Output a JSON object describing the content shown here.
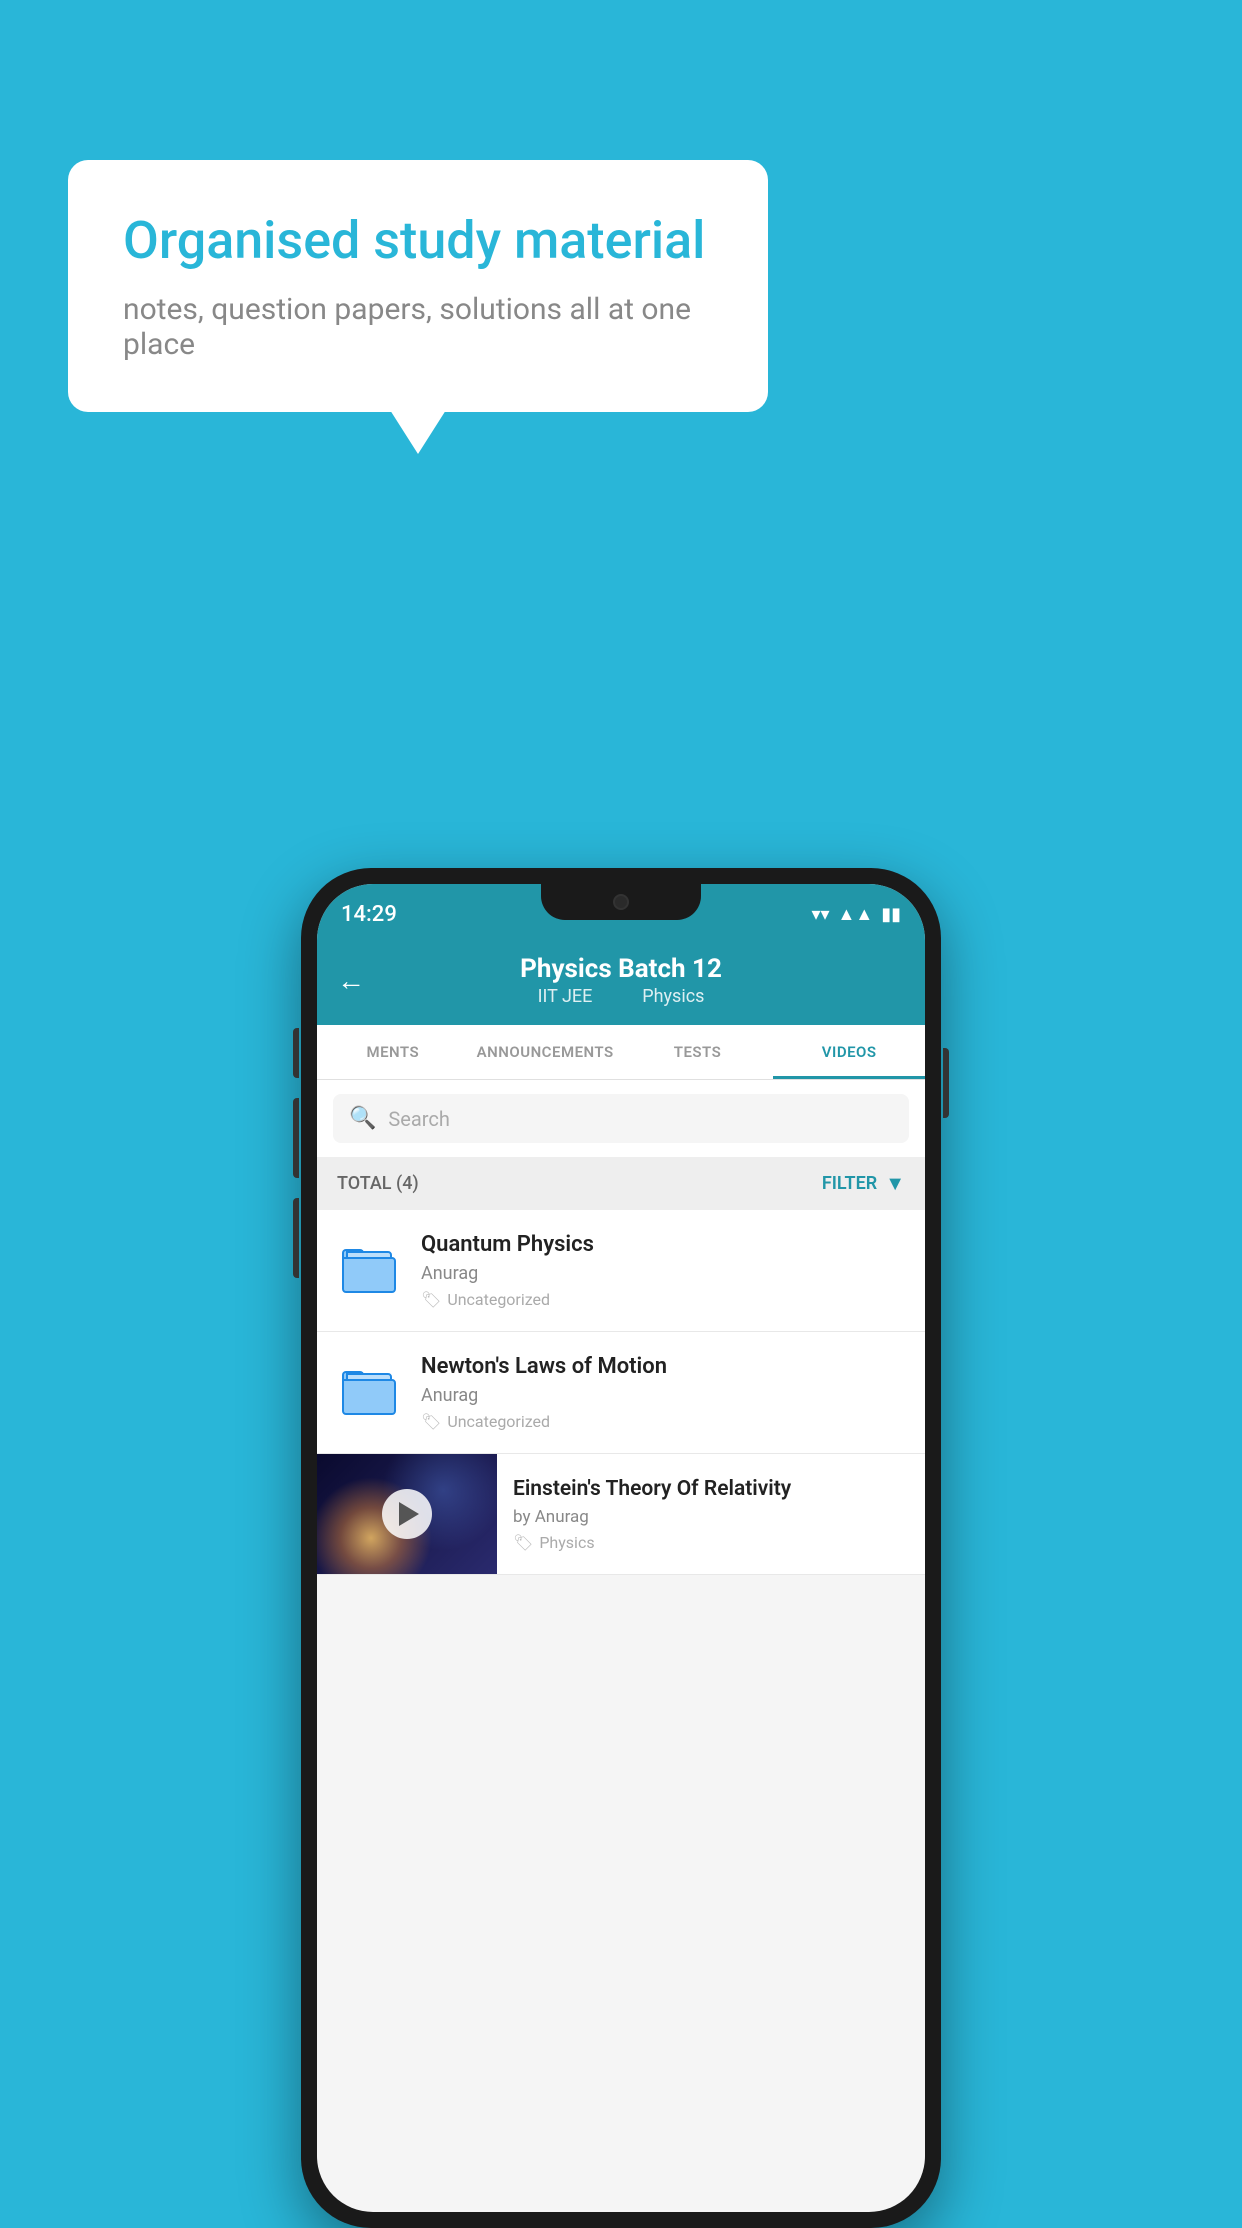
{
  "background_color": "#29B6D8",
  "speech_bubble": {
    "title": "Organised study material",
    "subtitle": "notes, question papers, solutions all at one place"
  },
  "status_bar": {
    "time": "14:29",
    "wifi": "▼",
    "signal": "▲",
    "battery": "▮"
  },
  "header": {
    "back_label": "←",
    "title": "Physics Batch 12",
    "subtitle_part1": "IIT JEE",
    "subtitle_part2": "Physics"
  },
  "tabs": [
    {
      "label": "MENTS",
      "active": false
    },
    {
      "label": "ANNOUNCEMENTS",
      "active": false
    },
    {
      "label": "TESTS",
      "active": false
    },
    {
      "label": "VIDEOS",
      "active": true
    }
  ],
  "search": {
    "placeholder": "Search"
  },
  "filter_bar": {
    "total_label": "TOTAL (4)",
    "filter_label": "FILTER"
  },
  "list_items": [
    {
      "id": "item1",
      "title": "Quantum Physics",
      "author": "Anurag",
      "tag": "Uncategorized",
      "type": "folder"
    },
    {
      "id": "item2",
      "title": "Newton's Laws of Motion",
      "author": "Anurag",
      "tag": "Uncategorized",
      "type": "folder"
    }
  ],
  "video_item": {
    "title": "Einstein's Theory Of Relativity",
    "author": "by Anurag",
    "tag": "Physics"
  },
  "icons": {
    "tag_icon": "🏷",
    "filter_icon": "▼"
  }
}
